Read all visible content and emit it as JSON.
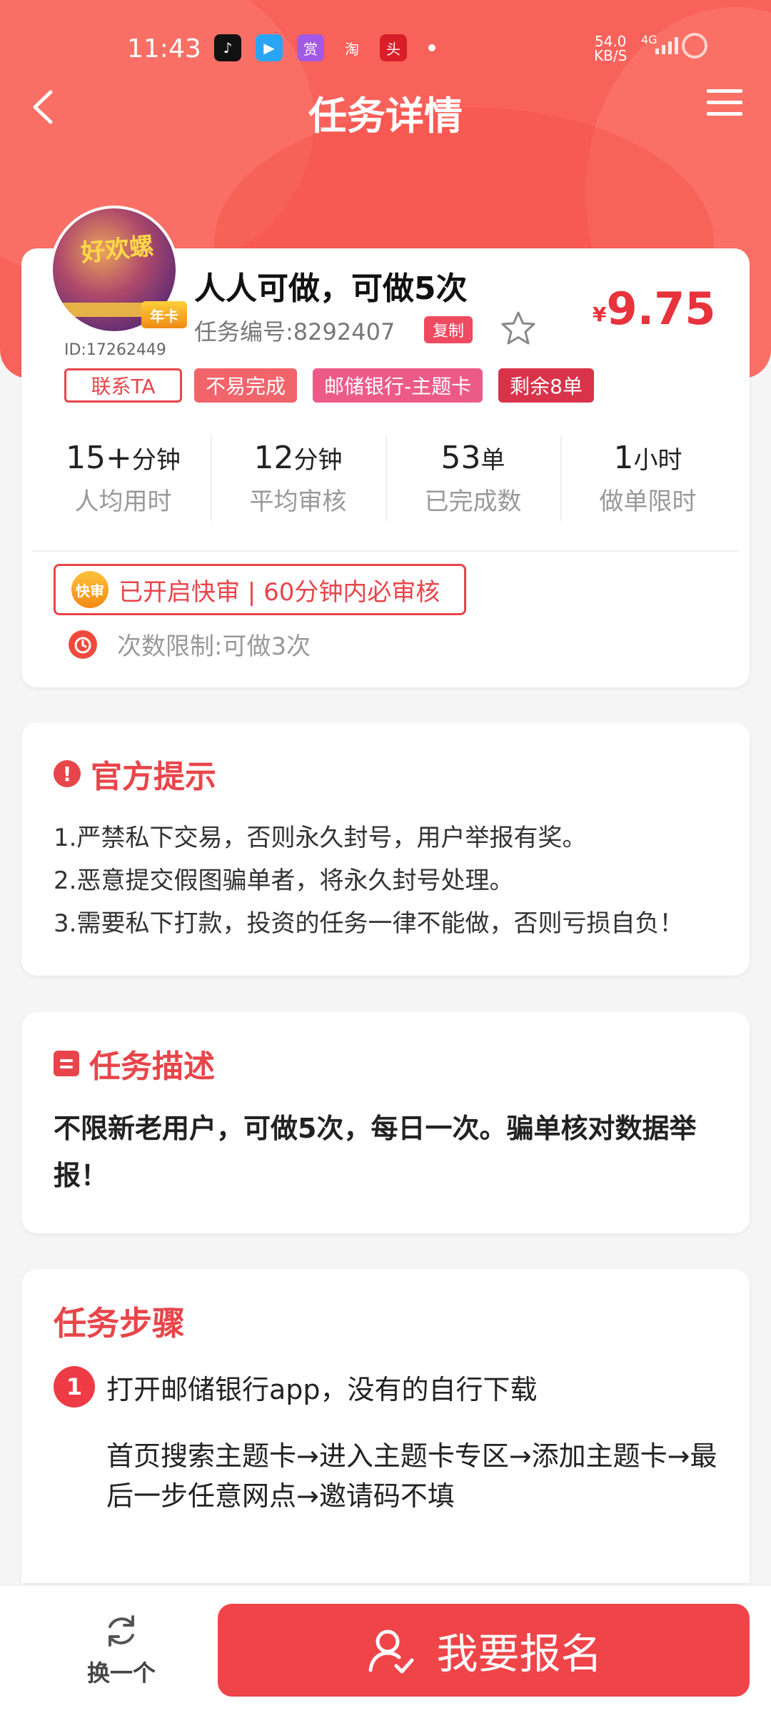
{
  "status_bar": {
    "time": "11:43",
    "apps": [
      {
        "icon": "tiktok-icon",
        "glyph": "♪",
        "color": "#111111"
      },
      {
        "icon": "video-icon",
        "glyph": "▶",
        "color": "#2aa4f4"
      },
      {
        "icon": "reward-app-icon",
        "glyph": "赏",
        "color": "#a25ae6"
      },
      {
        "icon": "taobao-icon",
        "glyph": "淘",
        "color": "#f9625a"
      },
      {
        "icon": "news-app-icon",
        "glyph": "头",
        "color": "#d91e2a"
      }
    ],
    "net_speed": "54.0",
    "net_unit": "KB/S",
    "network": "4G"
  },
  "nav": {
    "title": "任务详情"
  },
  "task": {
    "user_id": "ID:17262449",
    "contact_label": "联系TA",
    "title": "人人可做，可做5次",
    "task_no": "任务编号:8292407",
    "copy_label": "复制",
    "price_currency": "¥",
    "price": "9.75",
    "tags": [
      {
        "label": "不易完成",
        "color": "#f0646a"
      },
      {
        "label": "邮储银行-主题卡",
        "color": "#ec5b88"
      },
      {
        "label": "剩余8单",
        "color": "#d9334a"
      }
    ],
    "stats": [
      {
        "value": "15+",
        "unit": "分钟",
        "label": "人均用时"
      },
      {
        "value": "12",
        "unit": "分钟",
        "label": "平均审核"
      },
      {
        "value": "53",
        "unit": "单",
        "label": "已完成数"
      },
      {
        "value": "1",
        "unit": "小时",
        "label": "做单限时"
      }
    ],
    "quick_badge": "快审",
    "quick_text": "已开启快审 | 60分钟内必审核",
    "limit_text": "次数限制:可做3次"
  },
  "tips": {
    "title": "官方提示",
    "items": [
      "1.严禁私下交易，否则永久封号，用户举报有奖。",
      "2.恶意提交假图骗单者，将永久封号处理。",
      "3.需要私下打款，投资的任务一律不能做，否则亏损自负！"
    ]
  },
  "description": {
    "title": "任务描述",
    "text": "不限新老用户，可做5次，每日一次。骗单核对数据举报！"
  },
  "steps": {
    "title": "任务步骤",
    "items": [
      {
        "num": "1",
        "text": "打开邮储银行app，没有的自行下载",
        "detail": "首页搜索主题卡→进入主题卡专区→添加主题卡→最后一步任意网点→邀请码不填"
      }
    ]
  },
  "bottom": {
    "swap_label": "换一个",
    "signup_label": "我要报名"
  },
  "colors": {
    "accent": "#e8454a",
    "header": "#f9625a",
    "price": "#e8323c"
  }
}
